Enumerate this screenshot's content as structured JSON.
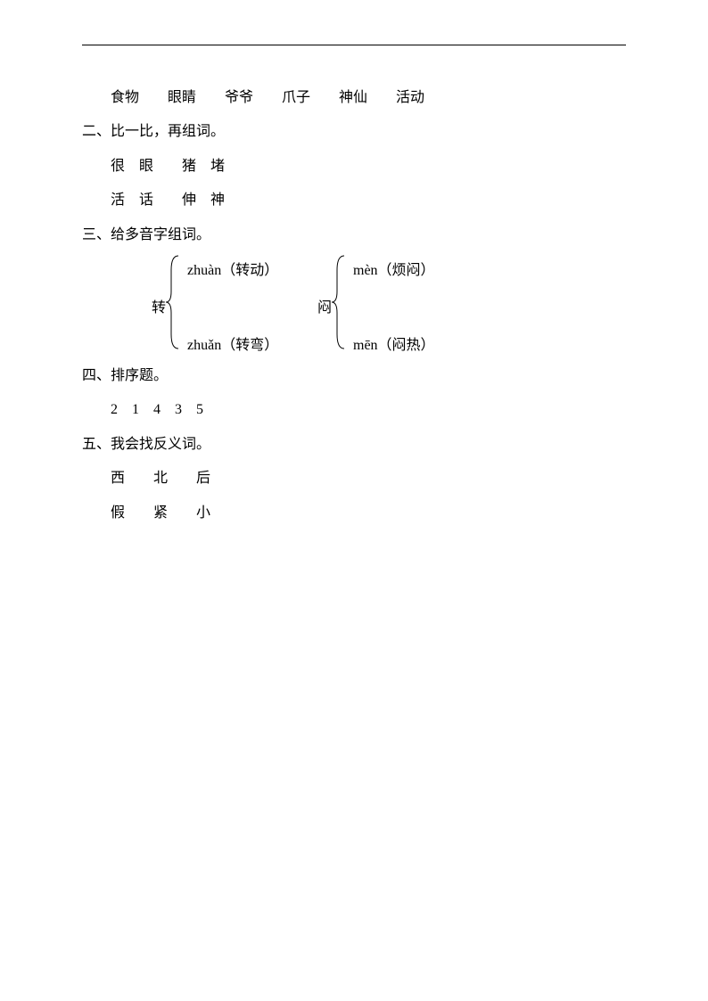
{
  "line1": "食物　　眼睛　　爷爷　　爪子　　神仙　　活动",
  "section2": {
    "heading": "二、比一比，再组词。",
    "row1": "很　眼　　猪　堵",
    "row2": "活　话　　伸　神"
  },
  "section3": {
    "heading": "三、给多音字组词。",
    "char1": "转",
    "char2": "闷",
    "readings": {
      "zhuan_top": "zhuàn（转动）",
      "zhuan_bot": "zhuǎn（转弯）",
      "men_top": "mèn（烦闷）",
      "men_bot": "mēn（闷热）"
    }
  },
  "section4": {
    "heading": "四、排序题。",
    "answer": "2　1　4　3　5"
  },
  "section5": {
    "heading": "五、我会找反义词。",
    "row1": "西　　北　　后",
    "row2": "假　　紧　　小"
  }
}
